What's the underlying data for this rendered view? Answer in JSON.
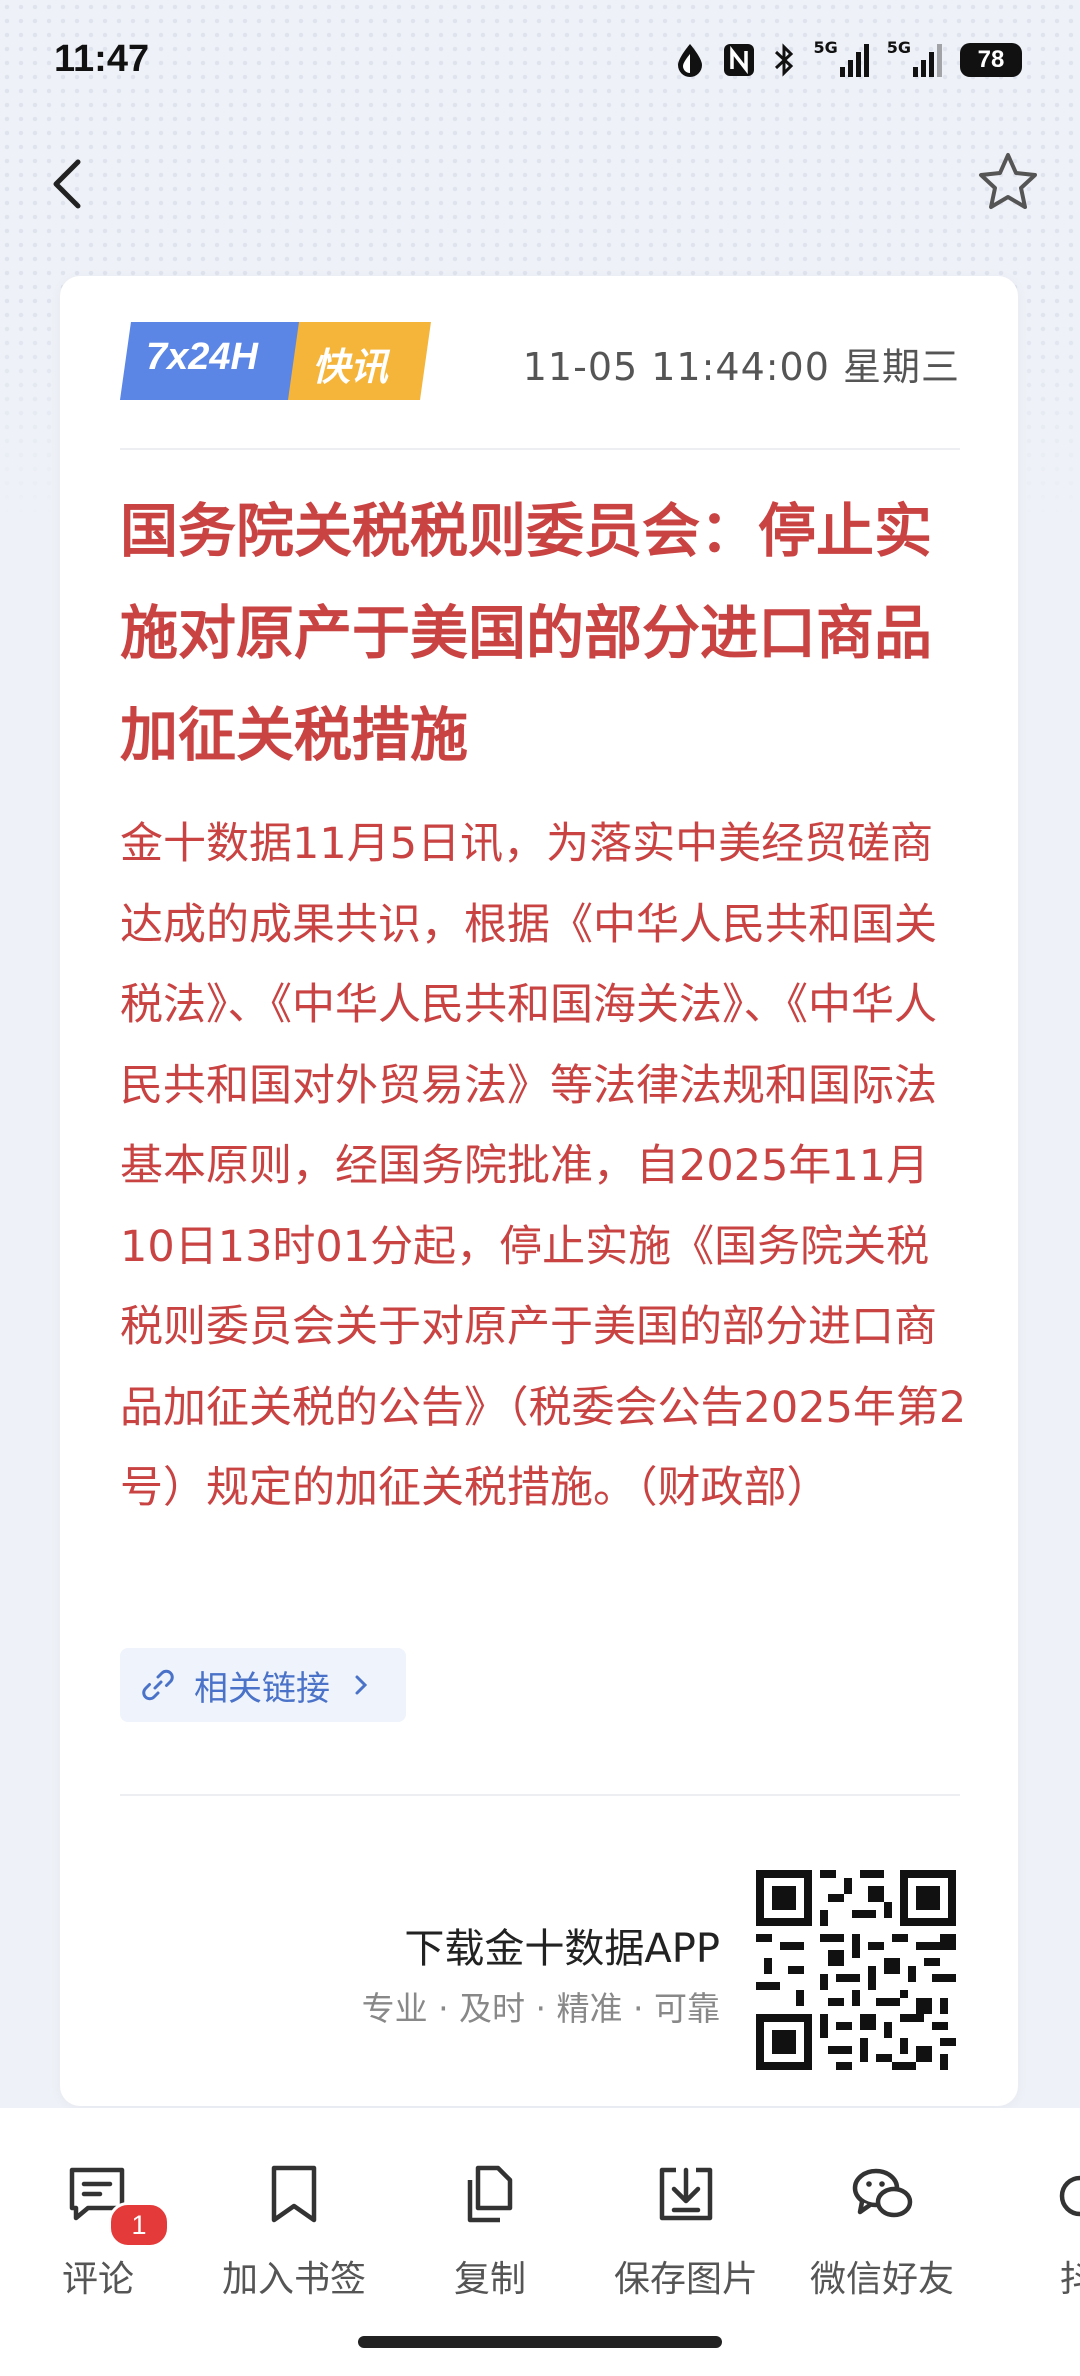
{
  "status_bar": {
    "time": "11:47",
    "network1": "5G",
    "network2": "5G",
    "battery": "78"
  },
  "header": {
    "back_icon": "chevron-left-icon",
    "favorite_icon": "star-outline-icon"
  },
  "article": {
    "badge_left": "7x24H",
    "badge_right": "快讯",
    "badge_colors": {
      "left": "#5b86e5",
      "right": "#f4b53a"
    },
    "datetime": "11-05 11:44:00 星期三",
    "headline": "国务院关税税则委员会：停止实施对原产于美国的部分进口商品加征关税措施",
    "body": "金十数据11月5日讯，为落实中美经贸磋商达成的成果共识，根据《中华人民共和国关税法》、《中华人民共和国海关法》、《中华人民共和国对外贸易法》等法律法规和国际法基本原则，经国务院批准，自2025年11月10日13时01分起，停止实施《国务院关税税则委员会关于对原产于美国的部分进口商品加征关税的公告》（税委会公告2025年第2号）规定的加征关税措施。（财政部）",
    "text_color": "#c94343",
    "related_link_label": "相关链接"
  },
  "promo": {
    "title": "下载金十数据APP",
    "tagline": "专业 · 及时 · 精准 · 可靠"
  },
  "bottom_actions": [
    {
      "label": "评论",
      "icon": "comment-icon",
      "badge": "1"
    },
    {
      "label": "加入书签",
      "icon": "bookmark-icon"
    },
    {
      "label": "复制",
      "icon": "copy-icon"
    },
    {
      "label": "保存图片",
      "icon": "save-image-icon"
    },
    {
      "label": "微信好友",
      "icon": "wechat-icon"
    },
    {
      "label": "抖",
      "icon": "douyin-icon"
    }
  ]
}
